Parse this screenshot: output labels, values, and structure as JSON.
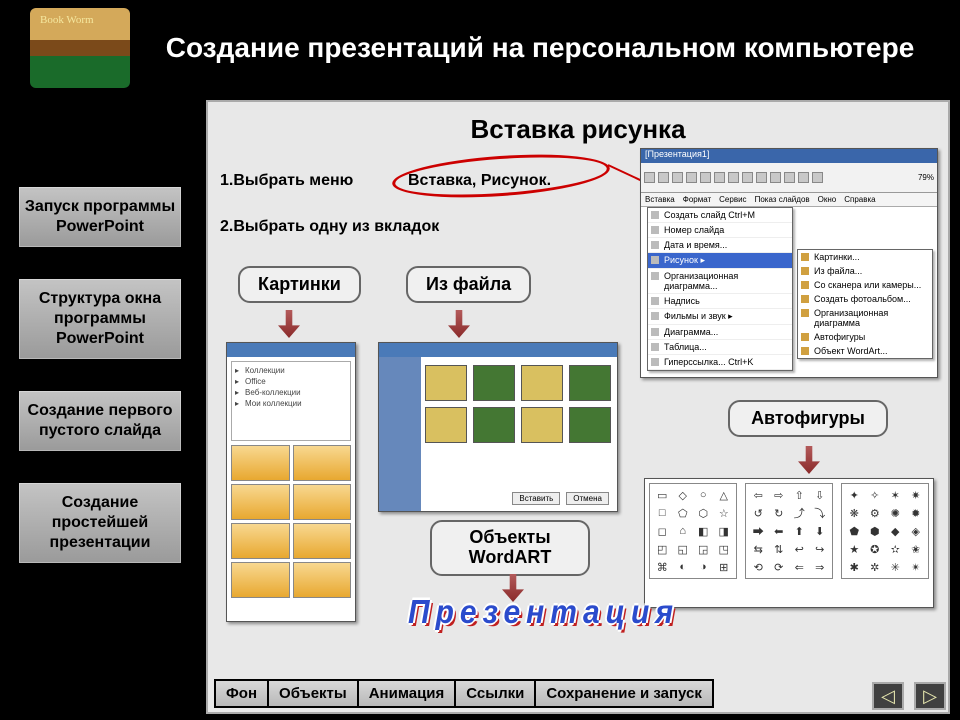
{
  "header": {
    "title": "Создание презентаций на персональном компьютере"
  },
  "sidebar": {
    "items": [
      {
        "label": "Запуск программы PowerPoint"
      },
      {
        "label": "Структура окна программы PowerPoint"
      },
      {
        "label": "Создание первого пустого слайда"
      },
      {
        "label": "Создание простейшей презентации"
      }
    ]
  },
  "slide": {
    "title": "Вставка рисунка",
    "step1_prefix": "1.Выбрать меню",
    "step1_circled": "Вставка, Рисунок.",
    "step2": "2.Выбрать одну из вкладок",
    "chips": {
      "pictures": "Картинки",
      "from_file": "Из файла",
      "autoshapes": "Автофигуры",
      "wordart": "Объекты WordART"
    },
    "wordart_sample": "Презентация"
  },
  "ppt_window": {
    "titlebar": "[Презентация1]",
    "zoom": "79%",
    "menubar": [
      "Вставка",
      "Формат",
      "Сервис",
      "Показ слайдов",
      "Окно",
      "Справка"
    ],
    "dropdown": [
      {
        "label": "Создать слайд",
        "accel": "Ctrl+M"
      },
      {
        "label": "Номер слайда"
      },
      {
        "label": "Дата и время..."
      },
      {
        "label": "Рисунок",
        "highlight": true,
        "submenu": true
      },
      {
        "label": "Организационная диаграмма..."
      },
      {
        "label": "Надпись"
      },
      {
        "label": "Фильмы и звук",
        "submenu": true
      },
      {
        "label": "Диаграмма..."
      },
      {
        "label": "Таблица..."
      },
      {
        "label": "Гиперссылка...",
        "accel": "Ctrl+K"
      }
    ],
    "submenu": [
      {
        "label": "Картинки..."
      },
      {
        "label": "Из файла..."
      },
      {
        "label": "Со сканера или камеры..."
      },
      {
        "label": "Создать фотоальбом..."
      },
      {
        "label": "Организационная диаграмма"
      },
      {
        "label": "Автофигуры"
      },
      {
        "label": "Объект WordArt..."
      }
    ]
  },
  "shape_glyphs": {
    "c1": [
      "▭",
      "◇",
      "○",
      "△",
      "□",
      "⬠",
      "⬡",
      "☆",
      "◻",
      "⌂",
      "◧",
      "◨",
      "◰",
      "◱",
      "◲",
      "◳",
      "⌘",
      "◐",
      "◑",
      "⊞"
    ],
    "c2": [
      "⇦",
      "⇨",
      "⇧",
      "⇩",
      "↺",
      "↻",
      "⤴",
      "⤵",
      "⮕",
      "⬅",
      "⬆",
      "⬇",
      "⇆",
      "⇅",
      "↩",
      "↪",
      "⟲",
      "⟳",
      "⇐",
      "⇒"
    ],
    "c3": [
      "✦",
      "✧",
      "✶",
      "✷",
      "❋",
      "⚙",
      "✺",
      "✹",
      "⬟",
      "⬢",
      "◆",
      "◈",
      "★",
      "✪",
      "✫",
      "✬",
      "✱",
      "✲",
      "✳",
      "✴"
    ]
  },
  "bottom_tabs": [
    "Фон",
    "Объекты",
    "Анимация",
    "Ссылки",
    "Сохранение и запуск"
  ],
  "pager": {
    "prev": "◁",
    "next": "▷"
  }
}
